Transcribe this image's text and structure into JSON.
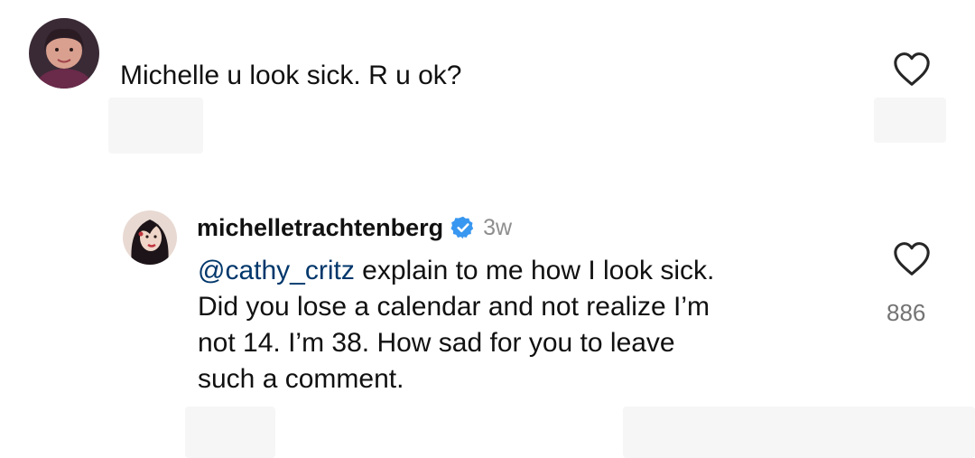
{
  "top_comment": {
    "text": "Michelle u look sick. R u ok?",
    "avatar_icon": "profile-photo-avatar",
    "like_icon": "heart-outline-icon"
  },
  "reply": {
    "username": "michelletrachtenberg",
    "verified_icon": "verified-badge-icon",
    "verified_color": "#3897f0",
    "time": "3w",
    "mention": "@cathy_critz",
    "lines": [
      " explain to me how I look sick.",
      "Did you lose a calendar and not realize I’m",
      "not 14. I’m 38. How sad for you to leave",
      "such a comment."
    ],
    "like_count": "886",
    "like_icon": "heart-outline-icon",
    "mention_color": "#00376b"
  }
}
